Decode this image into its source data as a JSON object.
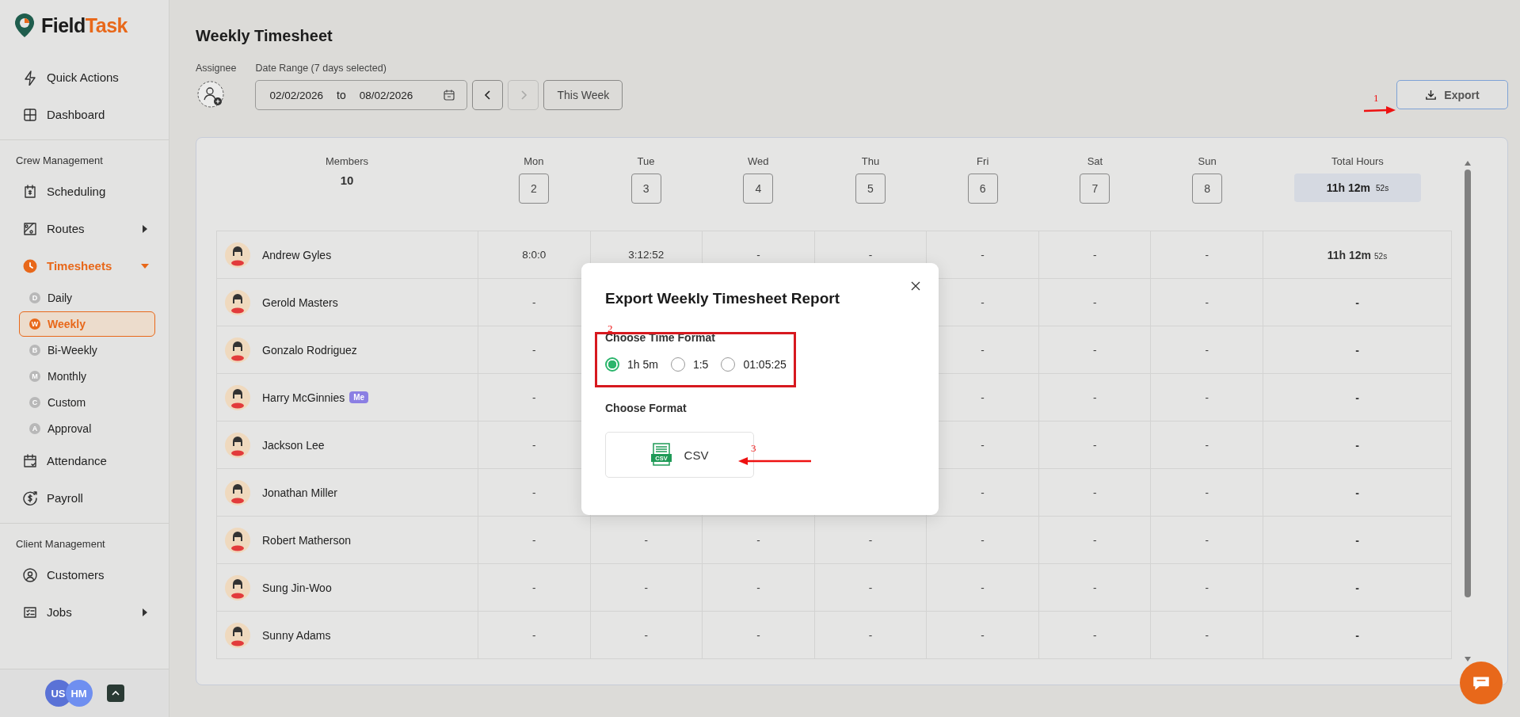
{
  "brand": {
    "first": "Field",
    "second": "Task"
  },
  "sidebar": {
    "sections": [
      {
        "items": [
          {
            "label": "Quick Actions",
            "active": false
          },
          {
            "label": "Dashboard",
            "active": false
          }
        ]
      },
      {
        "heading": "Crew Management",
        "items": [
          {
            "label": "Scheduling",
            "active": false
          },
          {
            "label": "Routes",
            "active": false,
            "expanded": false
          },
          {
            "label": "Timesheets",
            "active": true,
            "expanded": true,
            "children": [
              {
                "badge": "D",
                "label": "Daily",
                "selected": false
              },
              {
                "badge": "W",
                "label": "Weekly",
                "selected": true
              },
              {
                "badge": "B",
                "label": "Bi-Weekly",
                "selected": false
              },
              {
                "badge": "M",
                "label": "Monthly",
                "selected": false
              },
              {
                "badge": "C",
                "label": "Custom",
                "selected": false
              },
              {
                "badge": "A",
                "label": "Approval",
                "selected": false
              }
            ]
          },
          {
            "label": "Attendance",
            "active": false
          },
          {
            "label": "Payroll",
            "active": false
          }
        ]
      },
      {
        "heading": "Client Management",
        "items": [
          {
            "label": "Customers",
            "active": false
          },
          {
            "label": "Jobs",
            "active": false,
            "expanded": false
          }
        ]
      }
    ],
    "users": [
      {
        "initials": "US",
        "color": "#5a72d6"
      },
      {
        "initials": "HM",
        "color": "#6f8ff0"
      }
    ]
  },
  "page": {
    "title": "Weekly Timesheet",
    "assignee_label": "Assignee",
    "range_label": "Date Range (7 days selected)",
    "date_from": "02/02/2026",
    "date_sep": "to",
    "date_to": "08/02/2026",
    "prev_disabled": false,
    "next_disabled": true,
    "this_week": "This Week",
    "export": "Export"
  },
  "table": {
    "members_label": "Members",
    "members_count": "10",
    "total_label": "Total Hours",
    "total": {
      "main": "11h 12m",
      "sub": "52s"
    },
    "days": [
      {
        "name": "Mon",
        "date": "2"
      },
      {
        "name": "Tue",
        "date": "3"
      },
      {
        "name": "Wed",
        "date": "4"
      },
      {
        "name": "Thu",
        "date": "5"
      },
      {
        "name": "Fri",
        "date": "6"
      },
      {
        "name": "Sat",
        "date": "7"
      },
      {
        "name": "Sun",
        "date": "8"
      }
    ],
    "rows": [
      {
        "name": "Andrew Gyles",
        "cells": [
          "8:0:0",
          "3:12:52",
          "-",
          "-",
          "-",
          "-",
          "-"
        ],
        "total": {
          "main": "11h 12m",
          "sub": "52s"
        }
      },
      {
        "name": "Gerold Masters",
        "cells": [
          "-",
          null,
          null,
          null,
          "-",
          "-",
          "-"
        ],
        "total": {
          "main": "-"
        }
      },
      {
        "name": "Gonzalo Rodriguez",
        "cells": [
          "-",
          null,
          null,
          null,
          "-",
          "-",
          "-"
        ],
        "total": {
          "main": "-"
        }
      },
      {
        "name": "Harry McGinnies",
        "badge": "Me",
        "cells": [
          "-",
          null,
          null,
          null,
          "-",
          "-",
          "-"
        ],
        "total": {
          "main": "-"
        }
      },
      {
        "name": "Jackson Lee",
        "cells": [
          "-",
          null,
          null,
          null,
          "-",
          "-",
          "-"
        ],
        "total": {
          "main": "-"
        }
      },
      {
        "name": "Jonathan Miller",
        "cells": [
          "-",
          null,
          null,
          null,
          "-",
          "-",
          "-"
        ],
        "total": {
          "main": "-"
        }
      },
      {
        "name": "Robert Matherson",
        "cells": [
          "-",
          "-",
          "-",
          "-",
          "-",
          "-",
          "-"
        ],
        "total": {
          "main": "-"
        }
      },
      {
        "name": "Sung Jin-Woo",
        "cells": [
          "-",
          "-",
          "-",
          "-",
          "-",
          "-",
          "-"
        ],
        "total": {
          "main": "-"
        }
      },
      {
        "name": "Sunny Adams",
        "cells": [
          "-",
          "-",
          "-",
          "-",
          "-",
          "-",
          "-"
        ],
        "total": {
          "main": "-"
        }
      }
    ]
  },
  "modal": {
    "title": "Export Weekly Timesheet Report",
    "time_format_label": "Choose Time Format",
    "time_formats": [
      {
        "label": "1h 5m",
        "selected": true
      },
      {
        "label": "1:5",
        "selected": false
      },
      {
        "label": "01:05:25",
        "selected": false
      }
    ],
    "format_label": "Choose Format",
    "formats": [
      {
        "label": "CSV",
        "badge": "CSV"
      }
    ]
  },
  "annotations": [
    {
      "kind": "arrow",
      "number": "1"
    },
    {
      "kind": "box",
      "number": "2"
    },
    {
      "kind": "arrow",
      "number": "3"
    }
  ]
}
